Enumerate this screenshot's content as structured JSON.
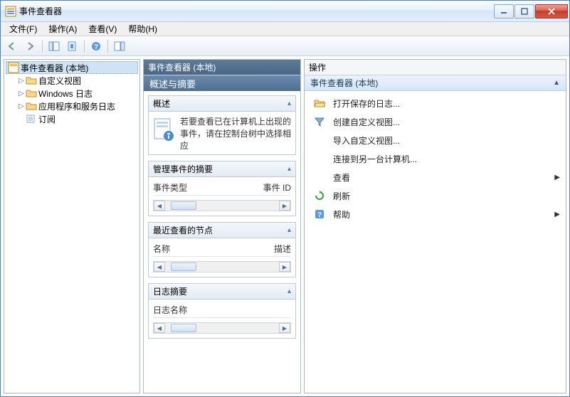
{
  "window": {
    "title": "事件查看器"
  },
  "menu": {
    "file": "文件(F)",
    "action": "操作(A)",
    "view": "查看(V)",
    "help": "帮助(H)"
  },
  "tree": {
    "root": "事件查看器 (本地)",
    "items": [
      {
        "label": "自定义视图",
        "expandable": true
      },
      {
        "label": "Windows 日志",
        "expandable": true
      },
      {
        "label": "应用程序和服务日志",
        "expandable": true
      },
      {
        "label": "订阅",
        "expandable": false
      }
    ]
  },
  "mid": {
    "header": "事件查看器 (本地)",
    "title": "概述与摘要",
    "sections": {
      "overview": {
        "title": "概述",
        "text": "若要查看已在计算机上出现的事件，请在控制台树中选择相应"
      },
      "summary": {
        "title": "管理事件的摘要",
        "col1": "事件类型",
        "col2": "事件 ID"
      },
      "recent": {
        "title": "最近查看的节点",
        "col1": "名称",
        "col2": "描述"
      },
      "log": {
        "title": "日志摘要",
        "col1": "日志名称"
      }
    }
  },
  "right": {
    "header": "操作",
    "sub": "事件查看器 (本地)",
    "actions": [
      {
        "icon": "folder-open",
        "label": "打开保存的日志...",
        "indent": false,
        "submenu": false
      },
      {
        "icon": "filter",
        "label": "创建自定义视图...",
        "indent": false,
        "submenu": false
      },
      {
        "icon": "",
        "label": "导入自定义视图...",
        "indent": true,
        "submenu": false
      },
      {
        "icon": "",
        "label": "连接到另一台计算机...",
        "indent": true,
        "submenu": false
      },
      {
        "icon": "",
        "label": "查看",
        "indent": true,
        "submenu": true
      },
      {
        "icon": "refresh",
        "label": "刷新",
        "indent": false,
        "submenu": false
      },
      {
        "icon": "help",
        "label": "帮助",
        "indent": false,
        "submenu": true
      }
    ]
  }
}
